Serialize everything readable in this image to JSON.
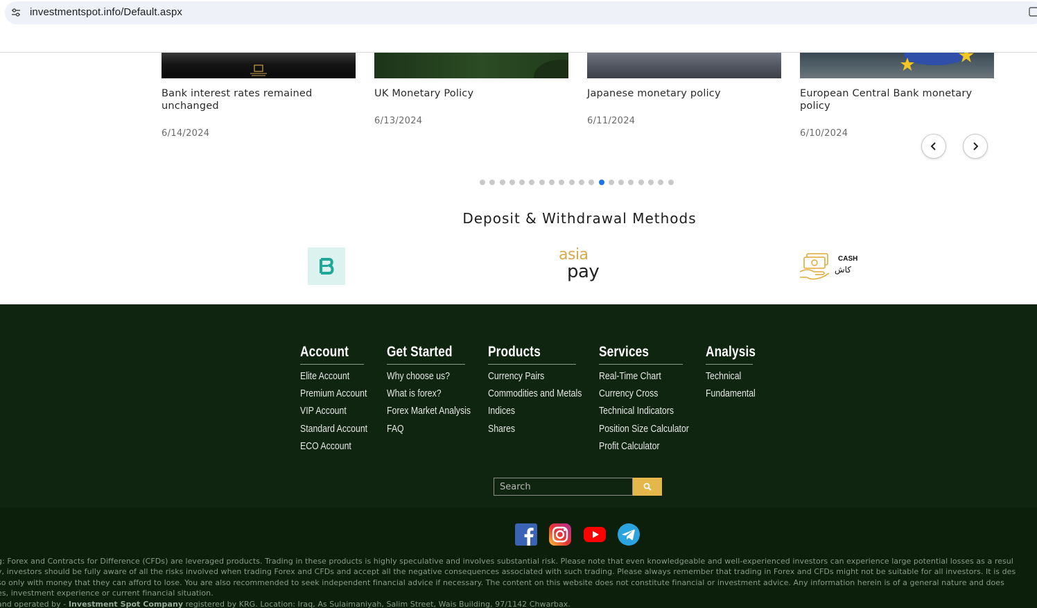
{
  "browser": {
    "url": "investmentspot.info/Default.aspx"
  },
  "news": [
    {
      "title_line1": "Bank interest rates remained",
      "title_line2": "unchanged",
      "date": "6/14/2024"
    },
    {
      "title_line1": "UK Monetary Policy",
      "title_line2": "",
      "date": "6/13/2024"
    },
    {
      "title_line1": "Japanese monetary policy",
      "title_line2": "",
      "date": "6/11/2024"
    },
    {
      "title_line1": "European Central Bank monetary",
      "title_line2": "policy",
      "date": "6/10/2024"
    }
  ],
  "carousel": {
    "dot_count": 20,
    "active_dot": 12,
    "prev_icon": "chevron-left-icon",
    "next_icon": "chevron-right-icon"
  },
  "deposit": {
    "heading": "Deposit & Withdrawal Methods",
    "methods": [
      {
        "name": "b-logo"
      },
      {
        "name": "asia-pay-logo",
        "text_top": "asia",
        "text_bottom": "pay"
      },
      {
        "name": "cash-logo",
        "text_en": "CASH",
        "text_ar": "كاش"
      }
    ]
  },
  "footer": {
    "columns": [
      {
        "title": "Account",
        "links": [
          "Elite Account",
          "Premium Account",
          "VIP Account",
          "Standard Account",
          "ECO Account"
        ]
      },
      {
        "title": "Get Started",
        "links": [
          "Why choose us?",
          "What is forex?",
          "Forex Market Analysis",
          "FAQ"
        ]
      },
      {
        "title": "Products",
        "links": [
          "Currency Pairs",
          "Commodities and Metals",
          "Indices",
          "Shares"
        ]
      },
      {
        "title": "Services",
        "links": [
          "Real-Time Chart",
          "Currency Cross",
          "Technical Indicators",
          "Position Size Calculator",
          "Profit Calculator"
        ]
      },
      {
        "title": "Analysis",
        "links": [
          "Technical",
          "Fundamental"
        ]
      }
    ],
    "search": {
      "placeholder": "Search",
      "button_icon": "search-icon"
    },
    "social": [
      "facebook-icon",
      "instagram-icon",
      "youtube-icon",
      "telegram-icon"
    ],
    "disclaimer": {
      "line1": "g: Forex and Contracts for Difference (CFDs) are leveraged products. Trading in these products is highly speculative and involves substantial risk. Please note that even knowledgeable and well-experienced investors can experience large potential losses as a resul",
      "line2": "y, investors should be fully aware of all the risks involved when trading Forex and CFDs and accept all the negative consequences associated with such trading. Please always remember that trading in Forex and CFDs might not be suitable for all investors. It is des",
      " line3": "",
      "line3": " so only with money that they can afford to lose. You are also recommended to seek independent financial advice if necessary. The content on this website does not constitute financial or investment advice. Any information herein is of a general nature and does",
      "line4": "es, investment experience or current financial situation.",
      "line5_prefix": "and operated by - ",
      "line5_company": "Investment Spot Company",
      "line5_suffix": " registered by KRG. Location: Iraq, As Sulaimaniyah, Salim Street, Wais Building, 97/1142 Chwarbax."
    }
  },
  "colors": {
    "footer_bg": "#0f2510",
    "bottom_bg": "#0b1f0b",
    "accent_gold": "#e5b64a",
    "active_dot": "#1a73e8"
  }
}
